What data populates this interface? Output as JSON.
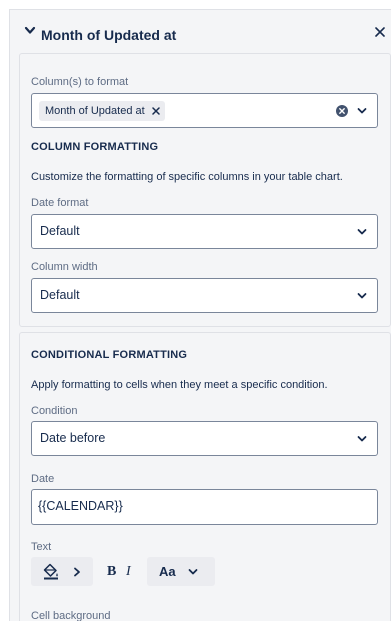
{
  "header": {
    "title": "Month of Updated at"
  },
  "column_select": {
    "label": "Column(s) to format",
    "chips": [
      "Month of Updated at"
    ]
  },
  "column_formatting": {
    "heading": "COLUMN FORMATTING",
    "description": "Customize the formatting of specific columns in your table chart.",
    "date_format": {
      "label": "Date format",
      "value": "Default"
    },
    "column_width": {
      "label": "Column width",
      "value": "Default"
    }
  },
  "conditional_formatting": {
    "heading": "CONDITIONAL FORMATTING",
    "description": "Apply formatting to cells when they meet a specific condition.",
    "condition": {
      "label": "Condition",
      "value": "Date before"
    },
    "date": {
      "label": "Date",
      "value": "{{CALENDAR}}"
    },
    "text": {
      "label": "Text",
      "bold_glyph": "B",
      "italic_glyph": "I",
      "font_size_glyph": "Aa"
    },
    "cell_background": {
      "label": "Cell background"
    }
  },
  "colors": {
    "panel_bg": "#f4f5f7",
    "border": "#dfe1e6",
    "field_border": "#7a869a",
    "text": "#172b4d",
    "muted": "#5e6c84"
  },
  "icons": [
    "chevron-down-icon",
    "close-icon",
    "clear-icon",
    "paint-bucket-icon",
    "chevron-right-icon"
  ]
}
